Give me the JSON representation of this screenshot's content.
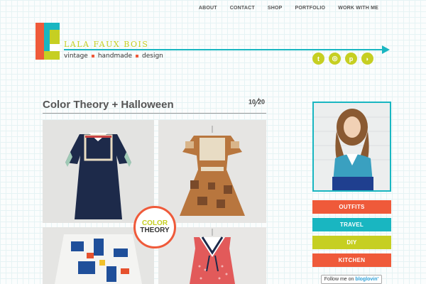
{
  "nav": [
    "ABOUT",
    "CONTACT",
    "SHOP",
    "PORTFOLIO",
    "WORK WITH ME"
  ],
  "brand": {
    "name": "LALA FAUX BOIS",
    "tagline": [
      "vintage",
      "handmade",
      "design"
    ],
    "colors": {
      "teal": "#19b6c1",
      "lime": "#c6cf22",
      "orange": "#ef5a3a"
    }
  },
  "social": [
    {
      "icon": "twitter-icon",
      "glyph": "t"
    },
    {
      "icon": "instagram-icon",
      "glyph": "◎"
    },
    {
      "icon": "pinterest-icon",
      "glyph": "p"
    },
    {
      "icon": "rss-icon",
      "glyph": "◗"
    }
  ],
  "post": {
    "title": "Color Theory + Halloween",
    "date_month": "10",
    "date_day": "20",
    "badge_line1": "COLOR",
    "badge_line2": "THEORY"
  },
  "sidebar": {
    "categories": [
      {
        "label": "OUTFITS",
        "color": "#ef5a3a"
      },
      {
        "label": "TRAVEL",
        "color": "#19b6c1"
      },
      {
        "label": "DIY",
        "color": "#c6cf22"
      },
      {
        "label": "KITCHEN",
        "color": "#ef5a3a"
      }
    ],
    "follow_prefix": "Follow me on",
    "follow_brand": "bloglovin'"
  }
}
